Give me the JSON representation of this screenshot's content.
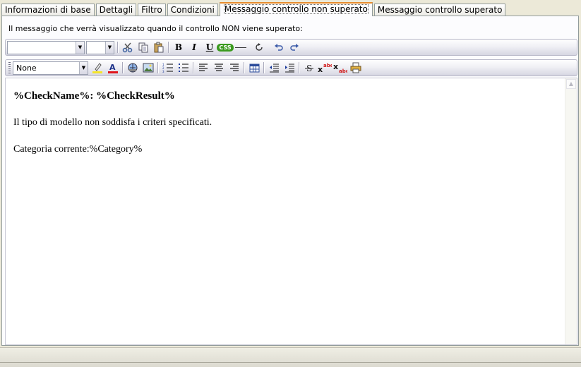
{
  "tabs": [
    {
      "label": "Informazioni di base",
      "active": false
    },
    {
      "label": "Dettagli",
      "active": false
    },
    {
      "label": "Filtro",
      "active": false
    },
    {
      "label": "Condizioni",
      "active": false
    },
    {
      "label": "Messaggio controllo non superato",
      "active": true
    },
    {
      "label": "Messaggio controllo superato",
      "active": false
    }
  ],
  "instruction": "Il messaggio che verrà visualizzato quando il controllo NON viene superato:",
  "toolbar1": {
    "font_family_value": "",
    "font_size_value": "",
    "buttons": [
      "cut",
      "copy",
      "paste",
      "bold",
      "italic",
      "underline",
      "css",
      "horizontal-rule",
      "refresh",
      "undo",
      "redo"
    ],
    "bold_glyph": "B",
    "italic_glyph": "I",
    "underline_glyph": "U",
    "css_badge": "CSS"
  },
  "toolbar2": {
    "style_value": "None",
    "buttons": [
      "highlight-color",
      "font-color",
      "hyperlink",
      "image",
      "numbered-list",
      "bulleted-list",
      "align-left",
      "align-center",
      "align-right",
      "table",
      "outdent",
      "indent",
      "strikethrough",
      "superscript",
      "subscript",
      "print"
    ]
  },
  "editor": {
    "heading": "%CheckName%: %CheckResult%",
    "line1": "Il tipo di modello non soddisfa i criteri specificati.",
    "line2": "Categoria corrente:%Category%"
  },
  "colors": {
    "active_tab_accent": "#e68b2c",
    "window_bg": "#ece9d8",
    "highlight_yellow": "#f5e52a",
    "font_color_red": "#e0141a"
  }
}
